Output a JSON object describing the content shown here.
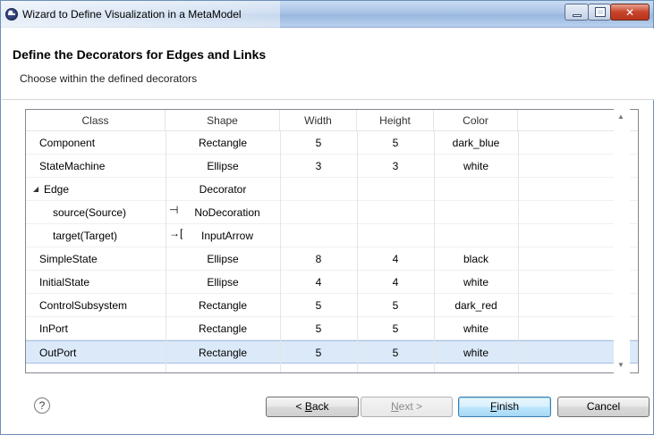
{
  "window": {
    "title": "Wizard to Define Visualization in a MetaModel"
  },
  "header": {
    "title": "Define the Decorators for Edges and Links",
    "subtitle": "Choose within the defined decorators"
  },
  "table": {
    "columns": [
      "Class",
      "Shape",
      "Width",
      "Height",
      "Color"
    ],
    "rows": [
      {
        "cls": "Component",
        "shape": "Rectangle",
        "width": "5",
        "height": "5",
        "color": "dark_blue"
      },
      {
        "cls": "StateMachine",
        "shape": "Ellipse",
        "width": "3",
        "height": "3",
        "color": "white"
      },
      {
        "cls": "Edge",
        "shape": "Decorator",
        "width": "",
        "height": "",
        "color": "",
        "expander": "◢"
      },
      {
        "cls": "source(Source)",
        "shape": "NoDecoration",
        "width": "",
        "height": "",
        "color": "",
        "icon": "⊣"
      },
      {
        "cls": "target(Target)",
        "shape": "InputArrow",
        "width": "",
        "height": "",
        "color": "",
        "icon": "→["
      },
      {
        "cls": "SimpleState",
        "shape": "Ellipse",
        "width": "8",
        "height": "4",
        "color": "black"
      },
      {
        "cls": "InitialState",
        "shape": "Ellipse",
        "width": "4",
        "height": "4",
        "color": "white"
      },
      {
        "cls": "ControlSubsystem",
        "shape": "Rectangle",
        "width": "5",
        "height": "5",
        "color": "dark_red"
      },
      {
        "cls": "InPort",
        "shape": "Rectangle",
        "width": "5",
        "height": "5",
        "color": "white"
      },
      {
        "cls": "OutPort",
        "shape": "Rectangle",
        "width": "5",
        "height": "5",
        "color": "white",
        "selected": true
      }
    ]
  },
  "buttons": {
    "help": "?",
    "back_prefix": "< ",
    "back_mnemonic": "B",
    "back_rest": "ack",
    "next_mnemonic": "N",
    "next_rest": "ext >",
    "finish_mnemonic": "F",
    "finish_rest": "inish",
    "cancel": "Cancel"
  },
  "colors": {
    "selection": "#dbe9f9",
    "default_button": "#bee6fd"
  }
}
